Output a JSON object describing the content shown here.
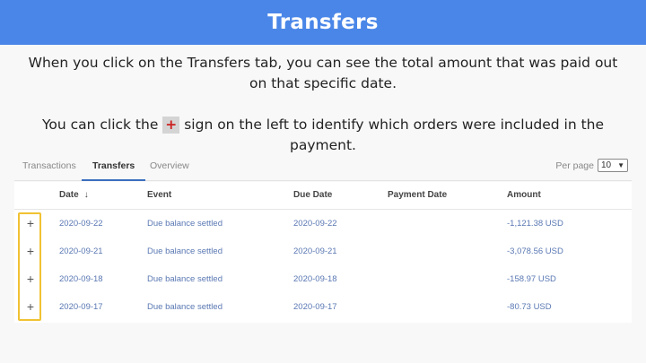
{
  "header": {
    "title": "Transfers"
  },
  "instructions": {
    "line1": "When you click on the Transfers tab, you can see the total amount that was paid out on that specific date.",
    "line2_before": "You can click the ",
    "line2_mark": "+",
    "line2_after": " sign on the left to identify which orders were included in the payment."
  },
  "tabs": [
    {
      "label": "Transactions"
    },
    {
      "label": "Transfers",
      "active": true
    },
    {
      "label": "Overview"
    }
  ],
  "per_page": {
    "label": "Per page",
    "value": "10"
  },
  "table": {
    "columns": [
      "Date",
      "Event",
      "Due Date",
      "Payment Date",
      "Amount"
    ],
    "sort_indicator": "↓",
    "expand_symbol": "+",
    "rows": [
      {
        "date": "2020-09-22",
        "event": "Due balance settled",
        "due_date": "2020-09-22",
        "payment_date": "",
        "amount": "-1,121.38 USD"
      },
      {
        "date": "2020-09-21",
        "event": "Due balance settled",
        "due_date": "2020-09-21",
        "payment_date": "",
        "amount": "-3,078.56 USD"
      },
      {
        "date": "2020-09-18",
        "event": "Due balance settled",
        "due_date": "2020-09-18",
        "payment_date": "",
        "amount": "-158.97 USD"
      },
      {
        "date": "2020-09-17",
        "event": "Due balance settled",
        "due_date": "2020-09-17",
        "payment_date": "",
        "amount": "-80.73 USD"
      }
    ]
  },
  "colors": {
    "header_bg": "#4a86e8",
    "highlight": "#f1c232",
    "plus_mark": "#cc1f1f",
    "link": "#5a78b3"
  }
}
